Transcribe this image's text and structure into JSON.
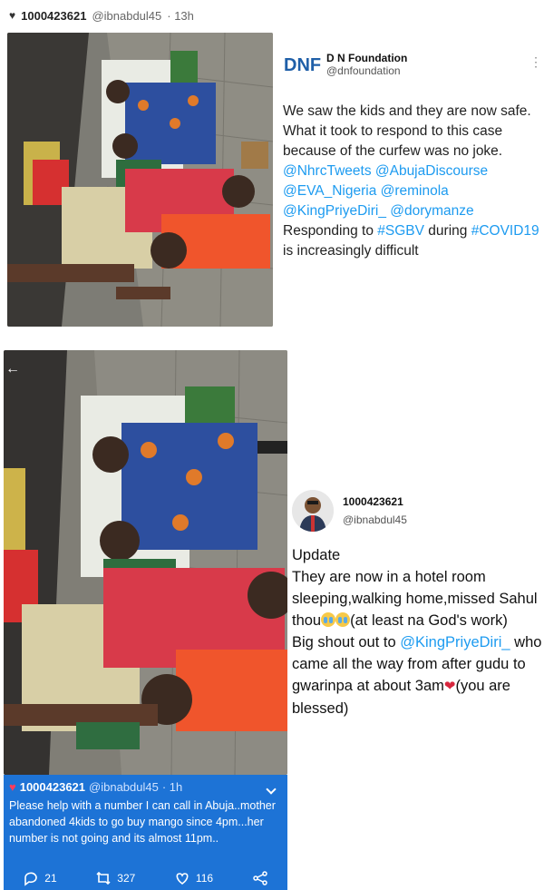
{
  "top_tweet": {
    "user_id": "1000423621",
    "handle": "@ibnabdul45",
    "time": "· 13h"
  },
  "dn_tweet": {
    "name": "D N Foundation",
    "handle": "@dnfoundation",
    "logo_text": "DNF",
    "text_1": "We saw the kids and they are now safe. What it took to respond to this case because of the curfew was no joke.",
    "mentions_1": "@NhrcTweets @AbujaDiscourse @EVA_Nigeria @reminola @KingPriyeDiri_ @dorymanze",
    "text_2": "Responding to",
    "hashtag_1": "#SGBV",
    "text_3": "during",
    "hashtag_2": "#COVID19",
    "text_4": "is increasingly difficult"
  },
  "update_tweet": {
    "name": "1000423621",
    "handle": "@ibnabdul45",
    "line_update": "Update",
    "text_1": "They are now in a hotel room sleeping,walking home,missed Sahul thou",
    "text_2": "(at least na God's work)",
    "text_3": "Big shout out to",
    "mention": "@KingPriyeDiri_",
    "text_4": "who came all the way from after gudu to gwarinpa at about 3am",
    "text_5": "(you are blessed)"
  },
  "blue_tweet": {
    "name": "1000423621",
    "handle": "@ibnabdul45",
    "time": "· 1h",
    "text": "Please help with a number I can call in Abuja..mother abandoned 4kids to go buy mango since 4pm...her number is not going and its almost 11pm..",
    "replies": "21",
    "retweets": "327",
    "likes": "116"
  },
  "colors": {
    "link": "#1d9bf0",
    "card_blue": "#1d73d6"
  }
}
